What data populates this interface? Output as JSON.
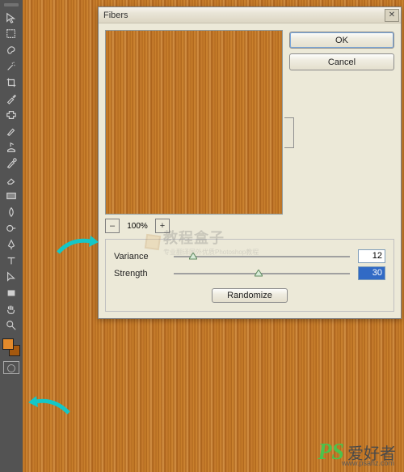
{
  "tools": {
    "foreground": "#e28a2b",
    "background": "#a4580e"
  },
  "dialog": {
    "title": "Fibers",
    "ok": "OK",
    "cancel": "Cancel",
    "zoom_minus": "–",
    "zoom_plus": "+",
    "zoom_pct": "100%",
    "variance_label": "Variance",
    "variance_value": "12",
    "strength_label": "Strength",
    "strength_value": "30",
    "randomize": "Randomize"
  },
  "watermark1": {
    "title": "教程盒子",
    "subtitle": "专业翻译国外优质Photoshop教程"
  },
  "watermark2": {
    "brand": "PS",
    "text": "爱好者",
    "url": "www.psahz.com"
  }
}
